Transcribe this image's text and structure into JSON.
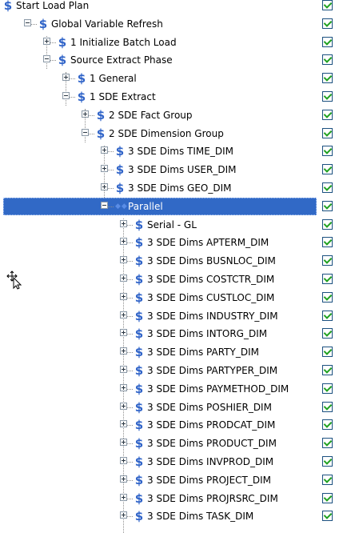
{
  "tree": {
    "rows": [
      {
        "label": "Start Load Plan",
        "level": 0,
        "expander": "none",
        "icon": "dollar",
        "checked": true
      },
      {
        "label": "Global Variable Refresh",
        "level": 1,
        "expander": "expanded",
        "icon": "dollar",
        "checked": true
      },
      {
        "label": "1 Initialize Batch Load",
        "level": 2,
        "expander": "collapsed",
        "icon": "dollar",
        "checked": true
      },
      {
        "label": "Source Extract Phase",
        "level": 2,
        "expander": "expanded",
        "icon": "dollar",
        "checked": true
      },
      {
        "label": "1 General",
        "level": 3,
        "expander": "collapsed",
        "icon": "dollar",
        "checked": true
      },
      {
        "label": "1 SDE Extract",
        "level": 3,
        "expander": "expanded",
        "icon": "dollar",
        "checked": true
      },
      {
        "label": "2 SDE Fact Group",
        "level": 4,
        "expander": "collapsed",
        "icon": "dollar",
        "checked": true
      },
      {
        "label": "2 SDE Dimension Group",
        "level": 4,
        "expander": "expanded",
        "icon": "dollar",
        "checked": true
      },
      {
        "label": "3 SDE Dims TIME_DIM",
        "level": 5,
        "expander": "collapsed",
        "icon": "dollar",
        "checked": true
      },
      {
        "label": "3 SDE Dims USER_DIM",
        "level": 5,
        "expander": "collapsed",
        "icon": "dollar",
        "checked": true
      },
      {
        "label": "3 SDE Dims GEO_DIM",
        "level": 5,
        "expander": "collapsed",
        "icon": "dollar",
        "checked": true
      },
      {
        "label": "Parallel",
        "level": 5,
        "expander": "expanded",
        "icon": "parallel",
        "checked": true,
        "selected": true
      },
      {
        "label": "Serial - GL",
        "level": 6,
        "expander": "collapsed",
        "icon": "dollar",
        "checked": true
      },
      {
        "label": "3 SDE Dims APTERM_DIM",
        "level": 6,
        "expander": "collapsed",
        "icon": "dollar",
        "checked": true
      },
      {
        "label": "3 SDE Dims BUSNLOC_DIM",
        "level": 6,
        "expander": "collapsed",
        "icon": "dollar",
        "checked": true
      },
      {
        "label": "3 SDE Dims COSTCTR_DIM",
        "level": 6,
        "expander": "collapsed",
        "icon": "dollar",
        "checked": true
      },
      {
        "label": "3 SDE Dims CUSTLOC_DIM",
        "level": 6,
        "expander": "collapsed",
        "icon": "dollar",
        "checked": true
      },
      {
        "label": "3 SDE Dims INDUSTRY_DIM",
        "level": 6,
        "expander": "collapsed",
        "icon": "dollar",
        "checked": true
      },
      {
        "label": "3 SDE Dims INTORG_DIM",
        "level": 6,
        "expander": "collapsed",
        "icon": "dollar",
        "checked": true
      },
      {
        "label": "3 SDE Dims PARTY_DIM",
        "level": 6,
        "expander": "collapsed",
        "icon": "dollar",
        "checked": true
      },
      {
        "label": "3 SDE Dims PARTYPER_DIM",
        "level": 6,
        "expander": "collapsed",
        "icon": "dollar",
        "checked": true
      },
      {
        "label": "3 SDE Dims PAYMETHOD_DIM",
        "level": 6,
        "expander": "collapsed",
        "icon": "dollar",
        "checked": true
      },
      {
        "label": "3 SDE Dims POSHIER_DIM",
        "level": 6,
        "expander": "collapsed",
        "icon": "dollar",
        "checked": true
      },
      {
        "label": "3 SDE Dims PRODCAT_DIM",
        "level": 6,
        "expander": "collapsed",
        "icon": "dollar",
        "checked": true
      },
      {
        "label": "3 SDE Dims PRODUCT_DIM",
        "level": 6,
        "expander": "collapsed",
        "icon": "dollar",
        "checked": true
      },
      {
        "label": "3 SDE Dims INVPROD_DIM",
        "level": 6,
        "expander": "collapsed",
        "icon": "dollar",
        "checked": true
      },
      {
        "label": "3 SDE Dims PROJECT_DIM",
        "level": 6,
        "expander": "collapsed",
        "icon": "dollar",
        "checked": true
      },
      {
        "label": "3 SDE Dims PROJRSRC_DIM",
        "level": 6,
        "expander": "collapsed",
        "icon": "dollar",
        "checked": true
      },
      {
        "label": "3 SDE Dims TASK_DIM",
        "level": 6,
        "expander": "collapsed",
        "icon": "dollar",
        "checked": true
      }
    ]
  },
  "icons": {
    "dollar": "dollar-sign-icon",
    "parallel": "parallel-icon"
  },
  "colors": {
    "selection": "#3169c6",
    "icon": "#2f63c8",
    "check": "#21a121"
  }
}
